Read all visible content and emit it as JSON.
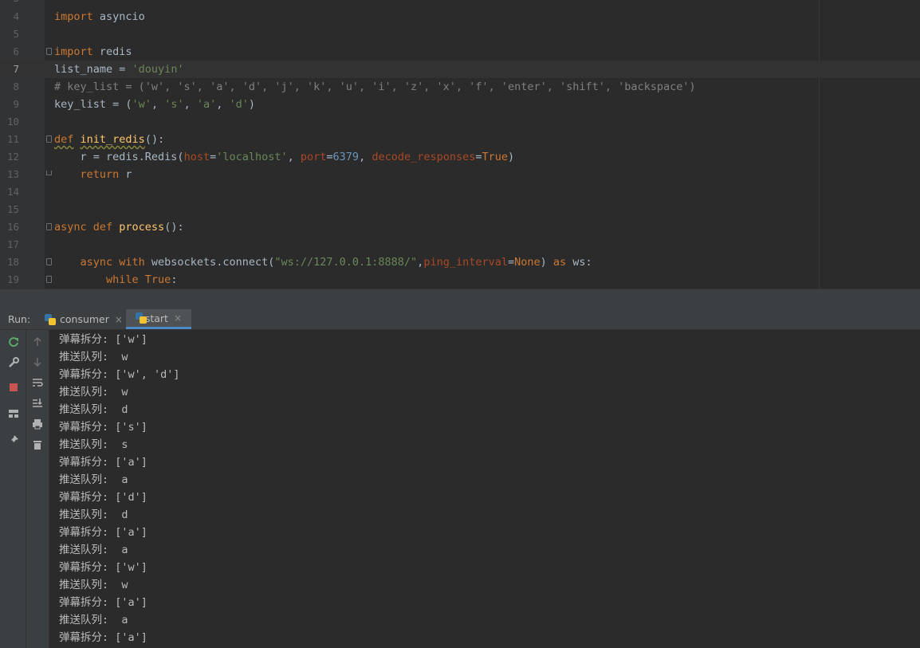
{
  "editor": {
    "first_partial_line": "3",
    "lines": [
      {
        "num": "4",
        "segs": [
          [
            "kw",
            "import"
          ],
          [
            "t",
            " asyncio"
          ]
        ]
      },
      {
        "num": "5",
        "segs": []
      },
      {
        "num": "6",
        "segs": [
          [
            "kw",
            "import"
          ],
          [
            "t",
            " redis"
          ]
        ],
        "fold": "start"
      },
      {
        "num": "7",
        "segs": [
          [
            "t",
            "list_name = "
          ],
          [
            "str",
            "'douyin'"
          ]
        ],
        "current": true
      },
      {
        "num": "8",
        "segs": [
          [
            "cmt",
            "# key_list = ('w', 's', 'a', 'd', 'j', 'k', 'u', 'i', 'z', 'x', 'f', 'enter', 'shift', 'backspace')"
          ]
        ]
      },
      {
        "num": "9",
        "segs": [
          [
            "t",
            "key_list = ("
          ],
          [
            "str",
            "'w'"
          ],
          [
            "t",
            ", "
          ],
          [
            "str",
            "'s'"
          ],
          [
            "t",
            ", "
          ],
          [
            "str",
            "'a'"
          ],
          [
            "t",
            ", "
          ],
          [
            "str",
            "'d'"
          ],
          [
            "t",
            ")"
          ]
        ]
      },
      {
        "num": "10",
        "segs": []
      },
      {
        "num": "11",
        "segs": [
          [
            "kwsq",
            "def"
          ],
          [
            "t",
            " "
          ],
          [
            "fnsq",
            "init_redis"
          ],
          [
            "t",
            "():"
          ]
        ],
        "fold": "start"
      },
      {
        "num": "12",
        "segs": [
          [
            "t",
            "    r = redis.Redis("
          ],
          [
            "param",
            "host"
          ],
          [
            "t",
            "="
          ],
          [
            "str",
            "'localhost'"
          ],
          [
            "t",
            ", "
          ],
          [
            "param",
            "port"
          ],
          [
            "t",
            "="
          ],
          [
            "num",
            "6379"
          ],
          [
            "t",
            ", "
          ],
          [
            "param",
            "decode_responses"
          ],
          [
            "t",
            "="
          ],
          [
            "kw",
            "True"
          ],
          [
            "t",
            ")"
          ]
        ]
      },
      {
        "num": "13",
        "segs": [
          [
            "t",
            "    "
          ],
          [
            "kw",
            "return"
          ],
          [
            "t",
            " r"
          ]
        ],
        "fold": "end"
      },
      {
        "num": "14",
        "segs": []
      },
      {
        "num": "15",
        "segs": []
      },
      {
        "num": "16",
        "segs": [
          [
            "kw",
            "async def "
          ],
          [
            "fn",
            "process"
          ],
          [
            "t",
            "():"
          ]
        ],
        "fold": "start"
      },
      {
        "num": "17",
        "segs": []
      },
      {
        "num": "18",
        "segs": [
          [
            "t",
            "    "
          ],
          [
            "kw",
            "async with"
          ],
          [
            "t",
            " websockets.connect("
          ],
          [
            "str",
            "\"ws://127.0.0.1:8888/\""
          ],
          [
            "t",
            ","
          ],
          [
            "param",
            "ping_interval"
          ],
          [
            "t",
            "="
          ],
          [
            "kw",
            "None"
          ],
          [
            "t",
            ") "
          ],
          [
            "kw",
            "as"
          ],
          [
            "t",
            " ws:"
          ]
        ],
        "fold": "start"
      },
      {
        "num": "19",
        "segs": [
          [
            "t",
            "        "
          ],
          [
            "kw",
            "while True"
          ],
          [
            "t",
            ":"
          ]
        ],
        "fold": "start"
      }
    ]
  },
  "run_panel": {
    "label": "Run:",
    "tabs": [
      {
        "label": "consumer",
        "active": false
      },
      {
        "label": "start",
        "active": true
      }
    ],
    "close_glyph": "×",
    "console_lines": [
      "弹幕拆分: ['w']",
      "推送队列:  w",
      "弹幕拆分: ['w', 'd']",
      "推送队列:  w",
      "推送队列:  d",
      "弹幕拆分: ['s']",
      "推送队列:  s",
      "弹幕拆分: ['a']",
      "推送队列:  a",
      "弹幕拆分: ['d']",
      "推送队列:  d",
      "弹幕拆分: ['a']",
      "推送队列:  a",
      "弹幕拆分: ['w']",
      "推送队列:  w",
      "弹幕拆分: ['a']",
      "推送队列:  a",
      "弹幕拆分: ['a']"
    ]
  },
  "colors": {
    "keyword": "#cc7832",
    "string": "#6a8759",
    "number": "#6897bb",
    "comment": "#808080",
    "function": "#ffc66d",
    "parameter": "#aa4926",
    "accent": "#4a88c7"
  }
}
